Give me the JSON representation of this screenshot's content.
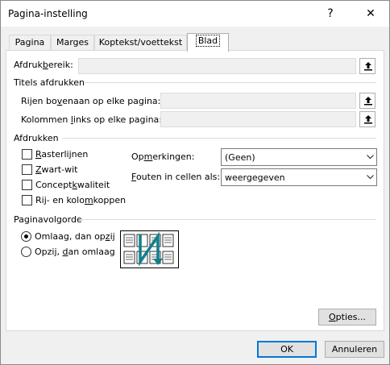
{
  "window": {
    "title": "Pagina-instelling",
    "help": "?",
    "close": "✕"
  },
  "tabs": [
    {
      "label": "Pagina"
    },
    {
      "label": "Marges"
    },
    {
      "label": "Koptekst/voettekst"
    },
    {
      "label": "Blad"
    }
  ],
  "print_area": {
    "pre": "Afdruk",
    "u": "b",
    "post": "ereik:",
    "value": ""
  },
  "print_titles": {
    "heading": "Titels afdrukken",
    "rows": {
      "pre": "Rijen bo",
      "u": "v",
      "post": "enaan op elke pagina:",
      "value": ""
    },
    "cols": {
      "pre": "Kolommen ",
      "u": "l",
      "post": "inks op elke pagina:",
      "value": ""
    }
  },
  "print": {
    "heading": "Afdrukken",
    "checkboxes": [
      {
        "pre": "",
        "u": "R",
        "post": "asterlijnen",
        "checked": false
      },
      {
        "pre": "",
        "u": "Z",
        "post": "wart-wit",
        "checked": false
      },
      {
        "pre": "Concept",
        "u": "k",
        "post": "waliteit",
        "checked": false
      },
      {
        "pre": "Rij- en kolo",
        "u": "m",
        "post": "koppen",
        "checked": false
      }
    ],
    "comments": {
      "pre": "Op",
      "u": "m",
      "post": "erkingen:",
      "value": "(Geen)"
    },
    "errors": {
      "pre": "",
      "u": "F",
      "post": "outen in cellen als:",
      "value": "weergegeven"
    }
  },
  "page_order": {
    "heading": "Paginavolgorde",
    "down_then_over": {
      "pre": "Omlaag, dan op",
      "u": "z",
      "post": "ij",
      "selected": true
    },
    "over_then_down": {
      "pre": "Opzij, ",
      "u": "d",
      "post": "an omlaag",
      "selected": false
    }
  },
  "buttons": {
    "options": {
      "pre": "",
      "u": "O",
      "post": "pties..."
    },
    "ok": "OK",
    "cancel": "Annuleren"
  },
  "colors": {
    "accent": "#0078d7",
    "order_arrow": "#0f7f8c"
  }
}
